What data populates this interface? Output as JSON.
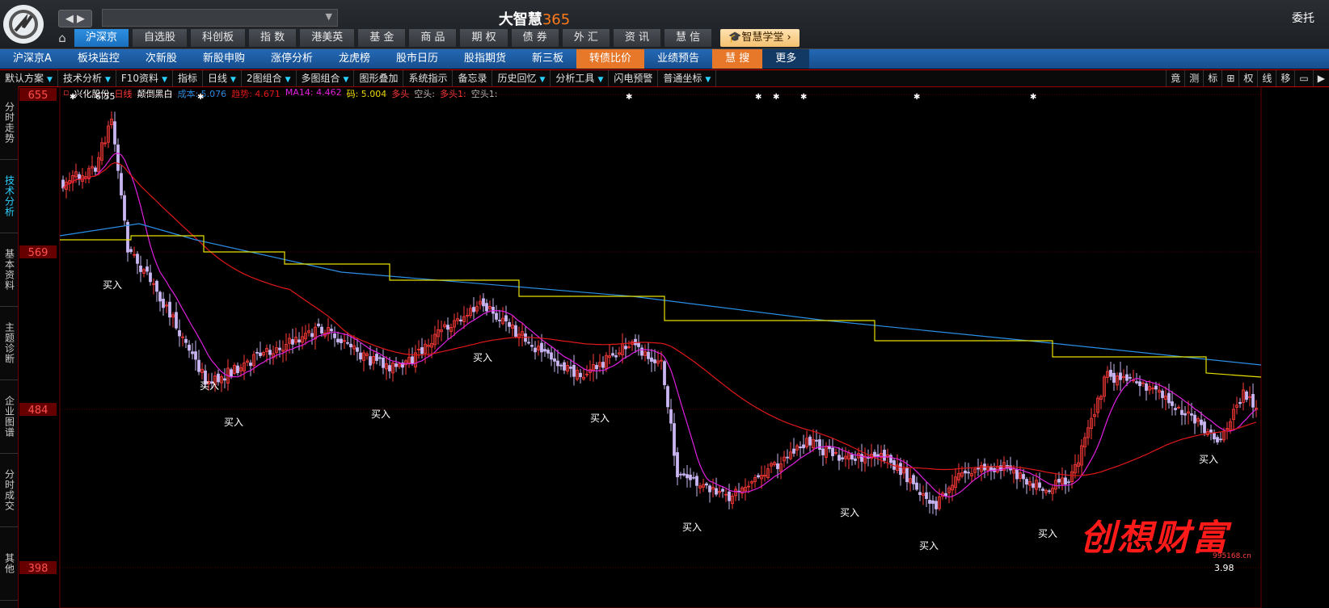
{
  "app": {
    "brand_text": "大智慧",
    "brand_num": "365",
    "right_label": "委托"
  },
  "nav": {
    "back_forward": "◀ ▶"
  },
  "main_tabs": [
    "沪深京",
    "自选股",
    "科创板",
    "指 数",
    "港美英",
    "基 金",
    "商 品",
    "期 权",
    "债 券",
    "外 汇",
    "资 讯",
    "慧 信"
  ],
  "academy_label": "智慧学堂",
  "sub_tabs": [
    "沪深京A",
    "板块监控",
    "次新股",
    "新股申购",
    "涨停分析",
    "龙虎榜",
    "股市日历",
    "股指期货",
    "新三板",
    "转债比价",
    "业绩预告",
    "慧 搜",
    "更多"
  ],
  "toolbar": {
    "items": [
      "默认方案",
      "技术分析",
      "F10资料",
      "指标",
      "日线",
      "2图组合",
      "多图组合",
      "图形叠加",
      "系统指示",
      "备忘录",
      "历史回忆",
      "分析工具",
      "闪电预警",
      "普通坐标"
    ],
    "right_items": [
      "竟",
      "测",
      "标",
      "⊞",
      "权",
      "线",
      "移",
      "▭",
      "▶"
    ]
  },
  "left_nav": [
    "分时走势",
    "技术分析",
    "基本资料",
    "主题诊断",
    "企业图谱",
    "分时成交",
    "其他"
  ],
  "info": {
    "stock": "兴化股份",
    "period": "日线",
    "mode": "颠倒黑白",
    "cost": "成本: 5.076",
    "trend": "趋势: 4.671",
    "ma14": "MA14: 4.462",
    "code": "码: 5.004",
    "duotou": "多头",
    "kongtou": "空头:",
    "duotou1": "多头1:",
    "kongtou1": "空头1:"
  },
  "axis": {
    "labels": [
      "655",
      "569",
      "484",
      "398"
    ]
  },
  "annotations": {
    "high": "6.55",
    "low": "3.98",
    "buy": "买入"
  },
  "watermark": {
    "text": "创想财富",
    "url": "995168.cn"
  },
  "colors": {
    "up": "#ff3a3a",
    "down": "#c9b6f2",
    "ma_magenta": "#e020e0",
    "ma_red": "#e01818",
    "ma_blue": "#2a8fe6",
    "ma_yellow": "#e8e000"
  }
}
